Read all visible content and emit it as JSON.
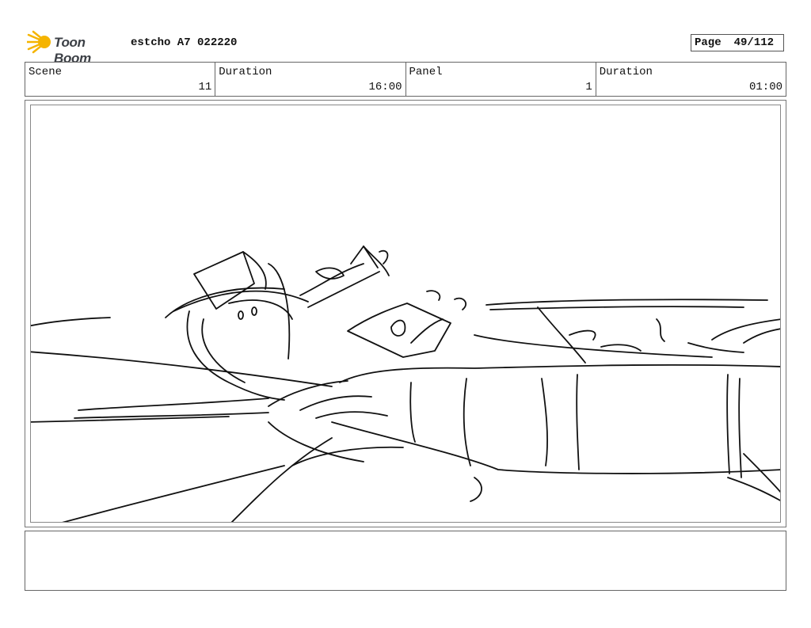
{
  "header": {
    "logo_text": "Toon Boom",
    "project_title": "estcho A7 022220",
    "page_label": "Page",
    "page_value": "49/112"
  },
  "info": {
    "scene_label": "Scene",
    "scene_value": "11",
    "scene_duration_label": "Duration",
    "scene_duration_value": "16:00",
    "panel_label": "Panel",
    "panel_value": "1",
    "panel_duration_label": "Duration",
    "panel_duration_value": "01:00"
  },
  "colors": {
    "logo_accent": "#f5b400",
    "sketch_ink": "#111111"
  }
}
